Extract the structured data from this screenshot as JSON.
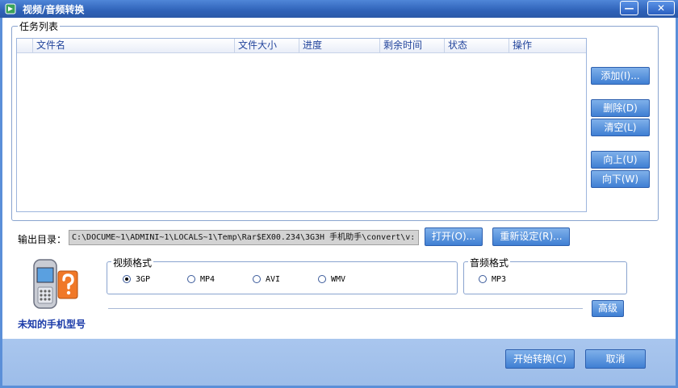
{
  "window": {
    "title": "视频/音频转换",
    "minimize_label": "—",
    "close_label": "✕"
  },
  "task_list": {
    "group_title": "任务列表",
    "columns": [
      "文件名",
      "文件大小",
      "进度",
      "剩余时间",
      "状态",
      "操作"
    ],
    "rows": []
  },
  "side_buttons": {
    "add": "添加(I)...",
    "delete": "删除(D)",
    "clear": "清空(L)",
    "up": "向上(U)",
    "down": "向下(W)"
  },
  "output": {
    "label": "输出目录：",
    "path": "C:\\DOCUME~1\\ADMINI~1\\LOCALS~1\\Temp\\Rar$EX00.234\\3G3H 手机助手\\convert\\v:",
    "open_button": "打开(O)...",
    "reset_button": "重新设定(R)..."
  },
  "phone": {
    "icon": "unknown-phone-icon",
    "model_label": "未知的手机型号"
  },
  "video_format": {
    "group_title": "视频格式",
    "options": [
      "3GP",
      "MP4",
      "AVI",
      "WMV"
    ],
    "selected": "3GP"
  },
  "audio_format": {
    "group_title": "音频格式",
    "options": [
      "MP3"
    ],
    "selected": ""
  },
  "advanced_button": "高级",
  "footer": {
    "start_button": "开始转换(C)",
    "cancel_button": "取消"
  },
  "colors": {
    "titlebar": "#2f62b8",
    "button": "#3f7fd3",
    "footer": "#a9c6ee",
    "accent_text": "#1a3aa8"
  }
}
